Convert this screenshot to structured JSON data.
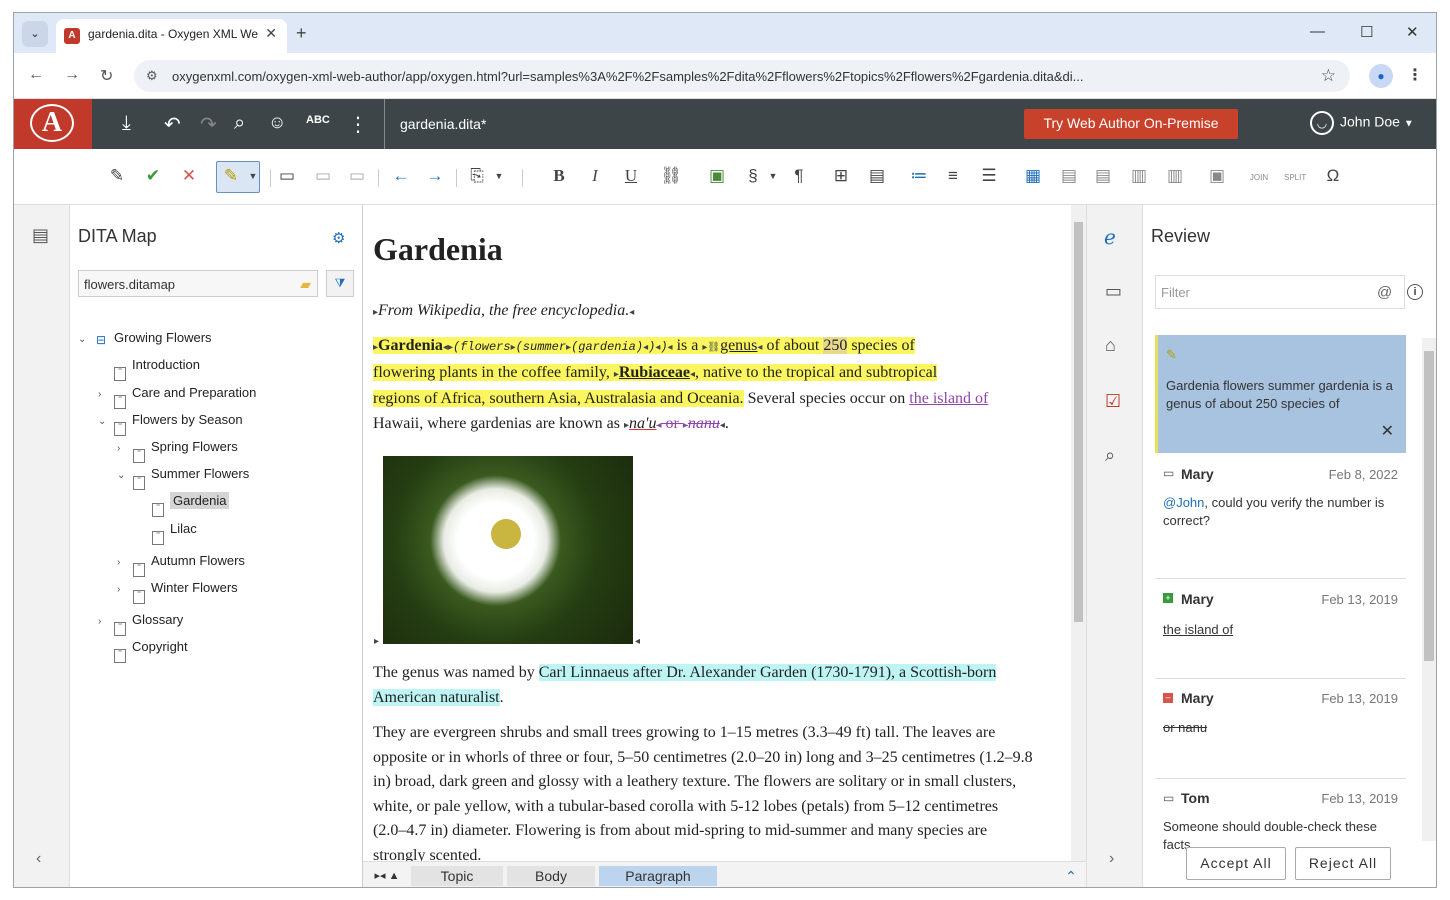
{
  "browser": {
    "tab_title": "gardenia.dita - Oxygen XML We",
    "url": "oxygenxml.com/oxygen-xml-web-author/app/oxygen.html?url=samples%3A%2F%2Fsamples%2Fdita%2Fflowers%2Ftopics%2Fflowers%2Fgardenia.dita&di..."
  },
  "app": {
    "doc_name": "gardenia.dita*",
    "try_button": "Try Web Author On-Premise",
    "user_name": "John Doe"
  },
  "map_panel": {
    "title": "DITA Map",
    "map_file": "flowers.ditamap",
    "tree": [
      {
        "label": "Growing Flowers"
      },
      {
        "label": "Introduction"
      },
      {
        "label": "Care and Preparation"
      },
      {
        "label": "Flowers by Season"
      },
      {
        "label": "Spring Flowers"
      },
      {
        "label": "Summer Flowers"
      },
      {
        "label": "Gardenia"
      },
      {
        "label": "Lilac"
      },
      {
        "label": "Autumn Flowers"
      },
      {
        "label": "Winter Flowers"
      },
      {
        "label": "Glossary"
      },
      {
        "label": "Copyright"
      }
    ]
  },
  "editor": {
    "title": "Gardenia",
    "shortdesc": "From Wikipedia, the free encyclopedia.",
    "p1": {
      "term": "Gardenia",
      "keywords": "(flowers",
      "kw2": "(summer",
      "kw3": "(gardenia)",
      "kw_close": ")",
      "is_a": " is a ",
      "genus": "genus",
      "of_about": " of about ",
      "num": "250",
      "species": " species of",
      "line2": "flowering plants in the coffee family, ",
      "rubiaceae": "Rubiaceae",
      "native": ", native to the tropical and subtropical",
      "line3": "regions of Africa, southern Asia, Australasia and Oceania.",
      "several": " Several species occur on ",
      "island": "the island of",
      "hawaii": " Hawaii, where gardenias are known as ",
      "nau": "na'u",
      "or_nanu_del": " or ",
      "nanu": "nanu",
      "end": "."
    },
    "p2_start": "The genus was named by ",
    "p2_hl": "Carl Linnaeus after Dr. Alexander Garden (1730-1791), a Scottish-born American naturalist",
    "p2_end": ".",
    "p3": "They are evergreen shrubs and small trees growing to 1–15 metres (3.3–49 ft) tall. The leaves are opposite or in whorls of three or four, 5–50 centimetres (2.0–20 in) long and 3–25 centimetres (1.2–9.8 in) broad, dark green and glossy with a leathery texture. The flowers are solitary or in small clusters, white, or pale yellow, with a tubular-based corolla with 5-12 lobes (petals) from 5–12 centimetres (2.0–4.7 in) diameter. Flowering is from about mid-spring to mid-summer and many species are strongly scented."
  },
  "breadcrumb": [
    "Topic",
    "Body",
    "Paragraph"
  ],
  "review": {
    "title": "Review",
    "filter_placeholder": "Filter",
    "cards": [
      {
        "text": "Gardenia flowers summer gardenia is a genus of about 250 species of"
      },
      {
        "who": "Mary",
        "date": "Feb 8, 2022",
        "mention": "@John",
        "text": ", could you verify the number is correct?"
      },
      {
        "who": "Mary",
        "date": "Feb 13, 2019",
        "text": "the island of"
      },
      {
        "who": "Mary",
        "date": "Feb 13, 2019",
        "text": "or nanu"
      },
      {
        "who": "Tom",
        "date": "Feb 13, 2019",
        "text": "Someone should double-check these facts."
      }
    ],
    "accept_all": "Accept All",
    "reject_all": "Reject All"
  },
  "colors": {
    "header_bg": "#3d4549",
    "logo_bg": "#c0392b",
    "try_btn": "#c8412a",
    "highlight_yellow": "#fbf65f",
    "highlight_cyan": "#bff4f4",
    "tracked_change": "#8e44ad",
    "active_card": "#a8c3df"
  }
}
